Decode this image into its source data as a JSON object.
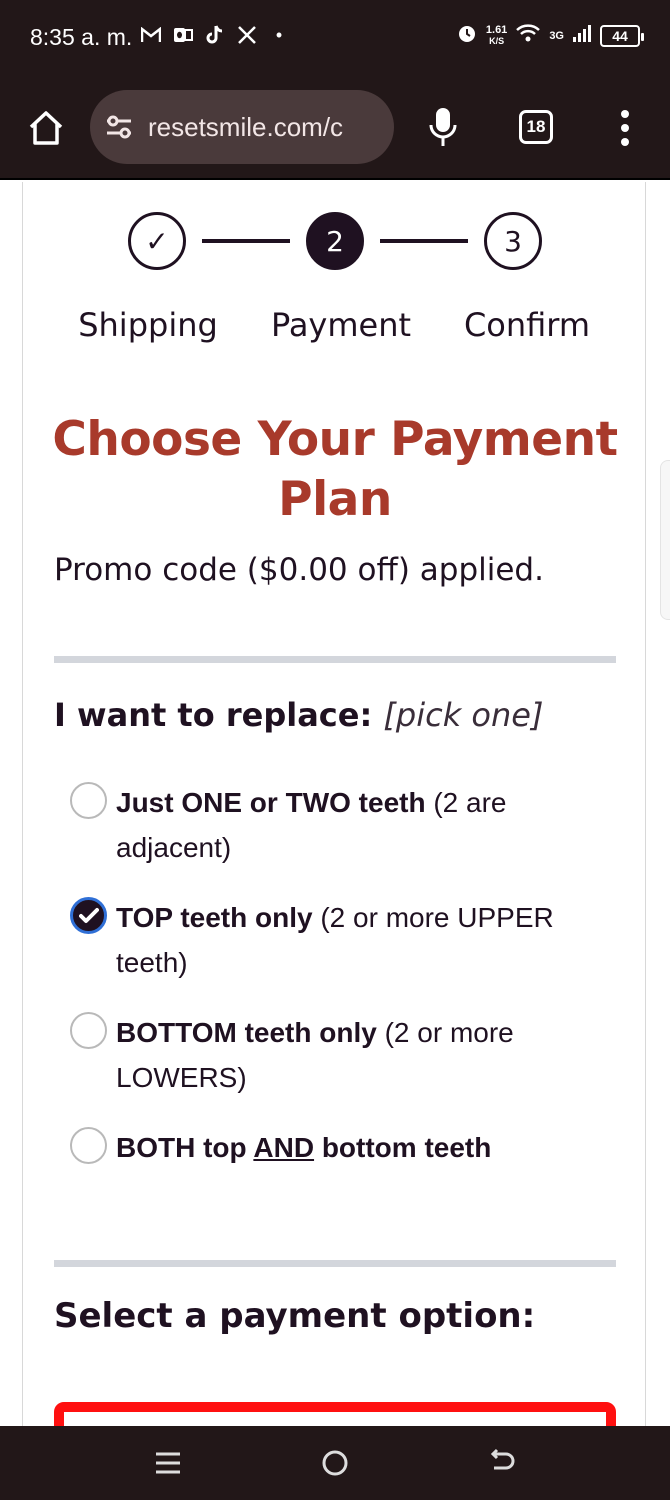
{
  "status_bar": {
    "time": "8:35 a. m.",
    "apps": [
      "gmail-icon",
      "outlook-icon",
      "tiktok-icon",
      "x-icon"
    ],
    "dot": "•",
    "speed_top": "1.61",
    "speed_bottom": "K/S",
    "network": "3G",
    "battery": "44"
  },
  "browser": {
    "url": "resetsmile.com/c",
    "tab_count": "18"
  },
  "stepper": {
    "steps": [
      {
        "label": "Shipping",
        "symbol": "✓",
        "state": "done"
      },
      {
        "label": "Payment",
        "symbol": "2",
        "state": "active"
      },
      {
        "label": "Confirm",
        "symbol": "3",
        "state": "pending"
      }
    ]
  },
  "main": {
    "title": "Choose Your Payment Plan",
    "promo": "Promo code ($0.00 off) applied.",
    "replace_heading": "I want to replace:",
    "replace_hint": "[pick one]",
    "options": [
      {
        "bold": "Just ONE or TWO teeth",
        "rest": " (2 are adjacent)",
        "checked": false
      },
      {
        "bold": "TOP teeth only",
        "rest": " (2 or more UPPER teeth)",
        "checked": true
      },
      {
        "bold": "BOTTOM teeth only",
        "rest": " (2 or more LOWERS)",
        "checked": false
      },
      {
        "bold_a": "BOTH top ",
        "underline": "AND",
        "bold_b": " bottom teeth",
        "checked": false
      }
    ],
    "payment_heading": "Select a payment option:"
  },
  "colors": {
    "title": "#a83a2b",
    "text": "#1f1121",
    "chrome": "#221718",
    "highlight_border": "#ff1010",
    "radio_focus": "#2f6fd6"
  }
}
